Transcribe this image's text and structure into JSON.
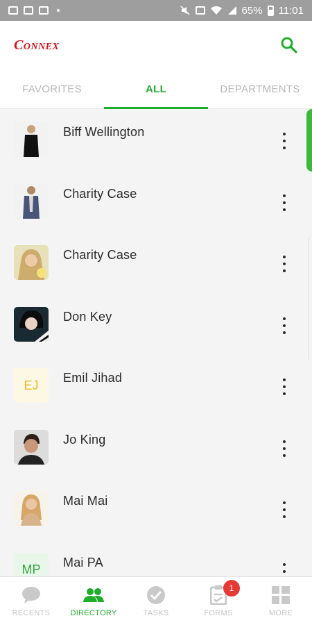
{
  "status_bar": {
    "battery": "65%",
    "time": "11:01"
  },
  "header": {
    "logo_text": "Connex",
    "search_icon": "search-icon"
  },
  "tabs": [
    {
      "label": "FAVORITES",
      "active": false
    },
    {
      "label": "ALL",
      "active": true
    },
    {
      "label": "DEPARTMENTS",
      "active": false
    }
  ],
  "contacts": [
    {
      "name": "Biff Wellington",
      "avatar": "photo"
    },
    {
      "name": "Charity Case",
      "avatar": "photo"
    },
    {
      "name": "Charity Case",
      "avatar": "photo"
    },
    {
      "name": "Don Key",
      "avatar": "photo"
    },
    {
      "name": "Emil Jihad",
      "avatar": "initials",
      "initials": "EJ"
    },
    {
      "name": "Jo King",
      "avatar": "photo"
    },
    {
      "name": "Mai Mai",
      "avatar": "photo"
    },
    {
      "name": "Mai PA",
      "avatar": "initials",
      "initials": "MP"
    }
  ],
  "bottom_nav": [
    {
      "label": "RECENTS",
      "icon": "chat-bubble-icon",
      "active": false
    },
    {
      "label": "DIRECTORY",
      "icon": "people-icon",
      "active": true
    },
    {
      "label": "TASKS",
      "icon": "check-circle-icon",
      "active": false
    },
    {
      "label": "FORMS",
      "icon": "form-icon",
      "active": false,
      "badge": "1"
    },
    {
      "label": "MORE",
      "icon": "grid-icon",
      "active": false
    }
  ],
  "colors": {
    "accent": "#1fae2b",
    "brand": "#d0121b",
    "badge": "#e53935"
  }
}
